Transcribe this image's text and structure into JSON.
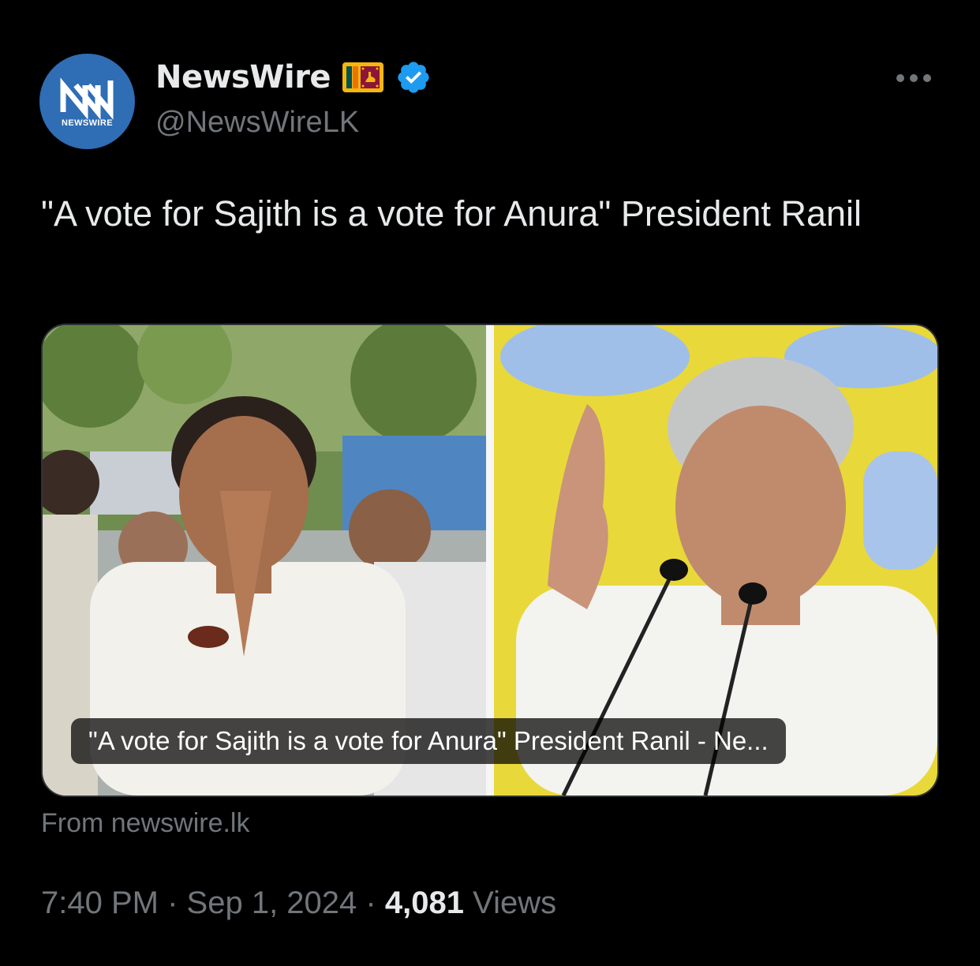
{
  "author": {
    "display_name": "NewsWire",
    "handle": "@NewsWireLK",
    "avatar_text": "NEWSWIRE",
    "badge_icon": "sri-lanka-flag-icon",
    "verified_icon": "verified-badge-icon",
    "verified_color": "#1d9bf0"
  },
  "tweet": {
    "text": "\"A vote for Sajith is a vote for Anura\" President Ranil"
  },
  "card": {
    "title": "\"A vote for Sajith is a vote for Anura\" President Ranil - Ne...",
    "source": "From newswire.lk"
  },
  "meta": {
    "time": "7:40 PM",
    "separator": "·",
    "date": "Sep 1, 2024",
    "views_count": "4,081",
    "views_label": "Views"
  },
  "colors": {
    "background": "#000000",
    "primary_text": "#e7e9ea",
    "secondary_text": "#71767b",
    "avatar_blue": "#2f6db4"
  }
}
